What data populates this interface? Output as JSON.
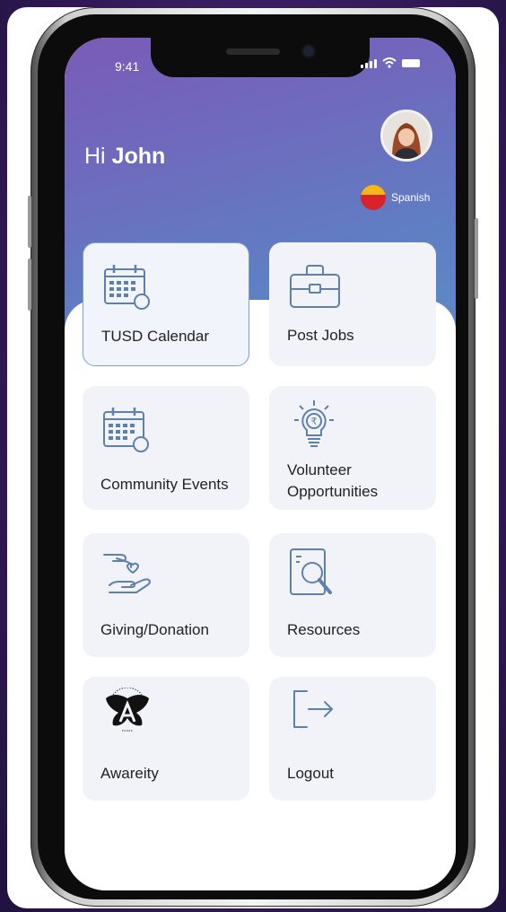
{
  "status_bar": {
    "time": "9:41"
  },
  "header": {
    "greeting_prefix": "Hi",
    "user_name": "John"
  },
  "language": {
    "label": "Spanish"
  },
  "tiles": [
    {
      "label": "TUSD Calendar",
      "icon": "calendar-icon",
      "selected": true
    },
    {
      "label": "Post Jobs",
      "icon": "briefcase-icon",
      "selected": false
    },
    {
      "label": "Community Events",
      "icon": "calendar-icon",
      "selected": false
    },
    {
      "label_line1": "Volunteer",
      "label_line2": "Opportunities",
      "icon": "lightbulb-rupee-icon",
      "selected": false
    },
    {
      "label": "Giving/Donation",
      "icon": "giving-hand-icon",
      "selected": false
    },
    {
      "label": "Resources",
      "icon": "document-search-icon",
      "selected": false
    },
    {
      "label": "Awareity",
      "icon": "awareity-logo",
      "selected": false
    },
    {
      "label": "Logout",
      "icon": "logout-icon",
      "selected": false
    }
  ],
  "colors": {
    "header_gradient_start": "#7a5bb8",
    "header_gradient_end": "#5c8cc6",
    "tile_background": "#f2f3f8",
    "icon_stroke": "#5e80ad",
    "selected_border": "#7fa0cf"
  }
}
